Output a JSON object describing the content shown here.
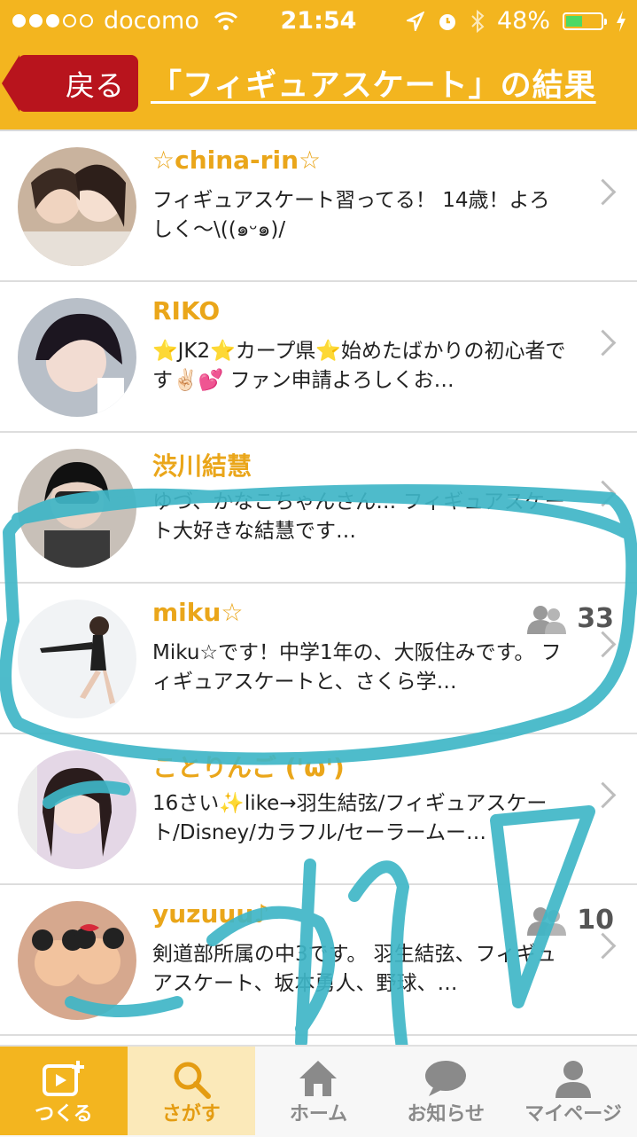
{
  "statusbar": {
    "carrier": "docomo",
    "time": "21:54",
    "battery": "48%",
    "battery_level": 0.48
  },
  "header": {
    "back_label": "戻る",
    "title": "「フィギュアスケート」の結果"
  },
  "results": [
    {
      "name": "☆china-rin☆",
      "desc": "フィギュアスケート習ってる！ 14歳！よろしく〜\\((๑ᵕ๑)/",
      "fans": ""
    },
    {
      "name": "RIKO",
      "desc": "⭐JK2⭐カープ県⭐始めたばかりの初心者です✌🏻💕 ファン申請よろしくお…",
      "fans": ""
    },
    {
      "name": "渋川結慧",
      "desc": "ゆづ、かなこちゃんさん… フィギュアスケート大好きな結慧です…",
      "fans": ""
    },
    {
      "name": "miku☆",
      "desc": "Miku☆です！中学1年の、大阪住みです。 フィギュアスケートと、さくら学…",
      "fans": "33"
    },
    {
      "name": "ことりんご ('ω')",
      "desc": "16さい✨like→羽生結弦/フィギュアスケート/Disney/カラフル/セーラームー…",
      "fans": ""
    },
    {
      "name": "yuzuuu♪",
      "desc": "剣道部所属の中3です。 羽生結弦、フィギュアスケート、坂本勇人、野球、…",
      "fans": "10"
    }
  ],
  "tabs": {
    "create": "つくる",
    "search": "さがす",
    "home": "ホーム",
    "notice": "お知らせ",
    "mypage": "マイページ"
  },
  "overlay": {
    "handwriting": "これ▽"
  },
  "colors": {
    "accent": "#f3b51f",
    "back_button": "#b8141d",
    "name_text": "#eaa61a",
    "scribble": "#3fb6c7"
  }
}
